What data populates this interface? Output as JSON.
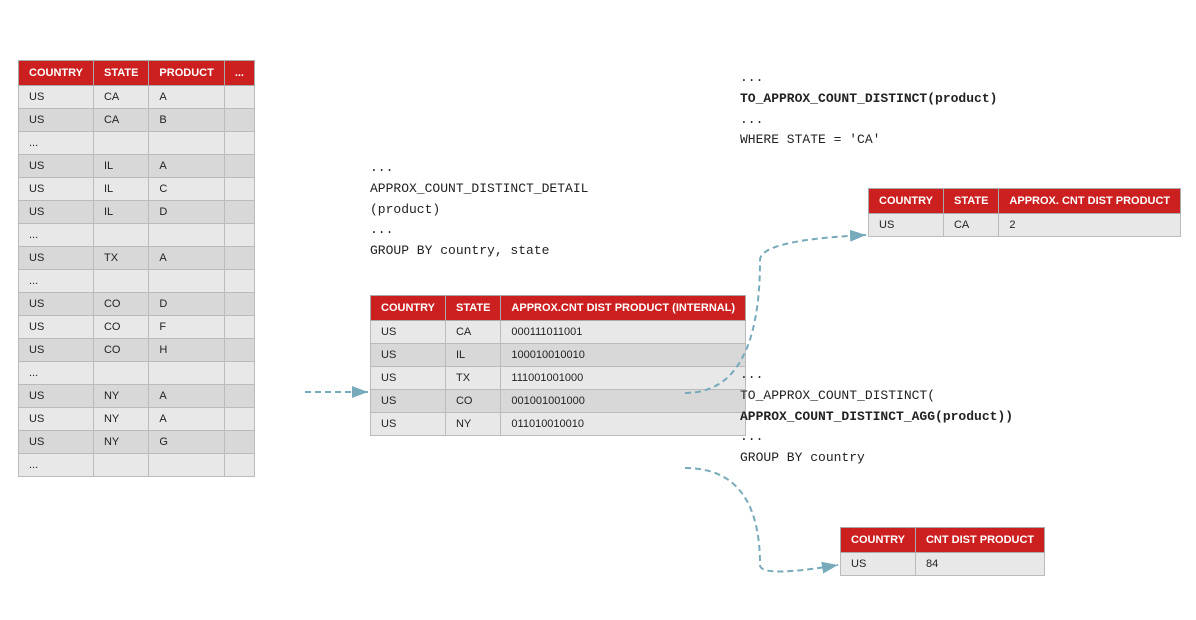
{
  "leftTable": {
    "headers": [
      "COUNTRY",
      "STATE",
      "PRODUCT",
      "..."
    ],
    "rows": [
      [
        "US",
        "CA",
        "A",
        ""
      ],
      [
        "US",
        "CA",
        "B",
        ""
      ],
      [
        "...",
        "",
        "",
        ""
      ],
      [
        "US",
        "IL",
        "A",
        ""
      ],
      [
        "US",
        "IL",
        "C",
        ""
      ],
      [
        "US",
        "IL",
        "D",
        ""
      ],
      [
        "...",
        "",
        "",
        ""
      ],
      [
        "US",
        "TX",
        "A",
        ""
      ],
      [
        "...",
        "",
        "",
        ""
      ],
      [
        "US",
        "CO",
        "D",
        ""
      ],
      [
        "US",
        "CO",
        "F",
        ""
      ],
      [
        "US",
        "CO",
        "H",
        ""
      ],
      [
        "...",
        "",
        "",
        ""
      ],
      [
        "US",
        "NY",
        "A",
        ""
      ],
      [
        "US",
        "NY",
        "A",
        ""
      ],
      [
        "US",
        "NY",
        "G",
        ""
      ],
      [
        "...",
        "",
        "",
        ""
      ]
    ]
  },
  "middleCode": {
    "line1": "...",
    "line2": "APPROX_COUNT_DISTINCT_DETAIL",
    "line3": "(product)",
    "line4": "...",
    "line5": "GROUP BY country, state"
  },
  "middleTable": {
    "headers": [
      "COUNTRY",
      "STATE",
      "APPROX.CNT DIST PRODUCT (INTERNAL)"
    ],
    "rows": [
      [
        "US",
        "CA",
        "000111011001"
      ],
      [
        "US",
        "IL",
        "100010010010"
      ],
      [
        "US",
        "TX",
        "111001001000"
      ],
      [
        "US",
        "CO",
        "001001001000"
      ],
      [
        "US",
        "NY",
        "011010010010"
      ]
    ]
  },
  "rightCodeTop": {
    "line1": "...",
    "line2": "TO_APPROX_COUNT_DISTINCT(product)",
    "line3": "...",
    "line4": "WHERE STATE = 'CA'"
  },
  "topRightTable": {
    "headers": [
      "COUNTRY",
      "STATE",
      "APPROX. CNT DIST PRODUCT"
    ],
    "rows": [
      [
        "US",
        "CA",
        "2"
      ]
    ]
  },
  "rightCodeMiddle": {
    "line1": "...",
    "line2": "TO_APPROX_COUNT_DISTINCT(",
    "line3": "APPROX_COUNT_DISTINCT_AGG(product))",
    "line4": "...",
    "line5": "GROUP BY country"
  },
  "bottomRightTable": {
    "headers": [
      "COUNTRY",
      "CNT DIST PRODUCT"
    ],
    "rows": [
      [
        "US",
        "84"
      ]
    ]
  }
}
